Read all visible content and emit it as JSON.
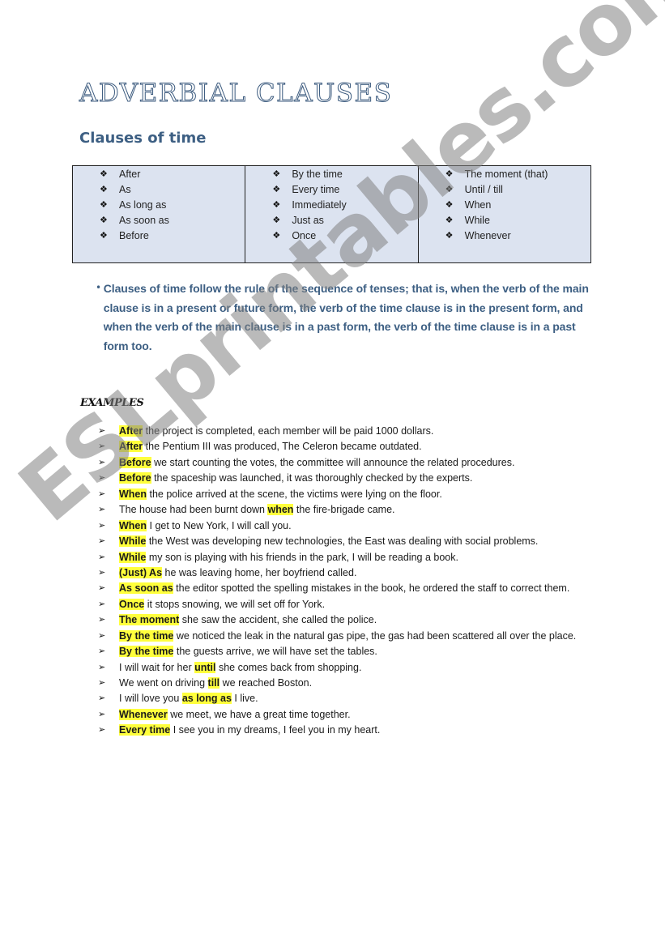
{
  "document": {
    "title": "Adverbial Clauses",
    "subtitle": "Clauses of time",
    "bullet_glyph": "❖",
    "conjunctions": [
      [
        "After",
        "As",
        "As long as",
        "As soon as",
        "Before"
      ],
      [
        "By the time",
        "Every time",
        "Immediately",
        "Just as",
        "Once"
      ],
      [
        "The moment (that)",
        "Until / till",
        "When",
        "While",
        "Whenever"
      ]
    ],
    "rule_bullet": "•",
    "rule_text": "Clauses of time follow the rule of the sequence of tenses; that is, when the verb of the main clause is in a present or future form, the verb of the time clause is in the present form, and when the verb of the main clause is in a past form, the verb of the time clause is in a past form too.",
    "examples_heading": "EXAMPLES",
    "example_arrow": "➢",
    "examples": [
      {
        "before": "",
        "highlight": "After",
        "after": " the project is completed, each member will be paid 1000 dollars."
      },
      {
        "before": "",
        "highlight": "After",
        "after": " the Pentium III was produced, The Celeron became outdated."
      },
      {
        "before": "",
        "highlight": "Before",
        "after": " we start counting the votes, the committee will announce the related procedures."
      },
      {
        "before": "",
        "highlight": "Before",
        "after": " the spaceship was launched, it was thoroughly checked by the experts."
      },
      {
        "before": "",
        "highlight": "When",
        "after": " the police arrived at the scene, the victims were lying on the floor."
      },
      {
        "before": "The house had been burnt down ",
        "highlight": "when",
        "after": " the fire-brigade came."
      },
      {
        "before": "",
        "highlight": "When",
        "after": " I get to New York, I will call you."
      },
      {
        "before": "",
        "highlight": "While",
        "after": " the West was developing new technologies, the East was dealing with social problems."
      },
      {
        "before": "",
        "highlight": "While",
        "after": " my son is playing with his friends in the park, I will be reading a book."
      },
      {
        "before": "",
        "highlight": "(Just) As",
        "after": " he was leaving home, her boyfriend called."
      },
      {
        "before": "",
        "highlight": "As soon as",
        "after": " the editor spotted the spelling mistakes in the book, he ordered the staff to correct them."
      },
      {
        "before": "",
        "highlight": "Once",
        "after": " it stops snowing, we will set off for York."
      },
      {
        "before": "",
        "highlight": "The moment",
        "after": " she saw the accident, she called the police."
      },
      {
        "before": "",
        "highlight": "By the time",
        "after": " we noticed the leak in the natural gas pipe, the gas had been scattered all over the place."
      },
      {
        "before": "",
        "highlight": "By the time",
        "after": " the guests arrive, we will have set the tables."
      },
      {
        "before": "I will wait for her ",
        "highlight": "until",
        "after": " she comes back from shopping."
      },
      {
        "before": "We went on driving ",
        "highlight": "till",
        "after": " we reached Boston."
      },
      {
        "before": "I will love you ",
        "highlight": "as long as",
        "after": " I live."
      },
      {
        "before": "",
        "highlight": "Whenever",
        "after": " we meet, we have a great time together."
      },
      {
        "before": "",
        "highlight": "Every time",
        "after": " I see you in my dreams, I feel you in my heart."
      }
    ],
    "watermark": "ESLprintables.com"
  },
  "colors": {
    "heading": "#3d5f83",
    "table_bg": "#dce3f0",
    "highlight": "#ffff3c",
    "watermark": "#828282"
  }
}
